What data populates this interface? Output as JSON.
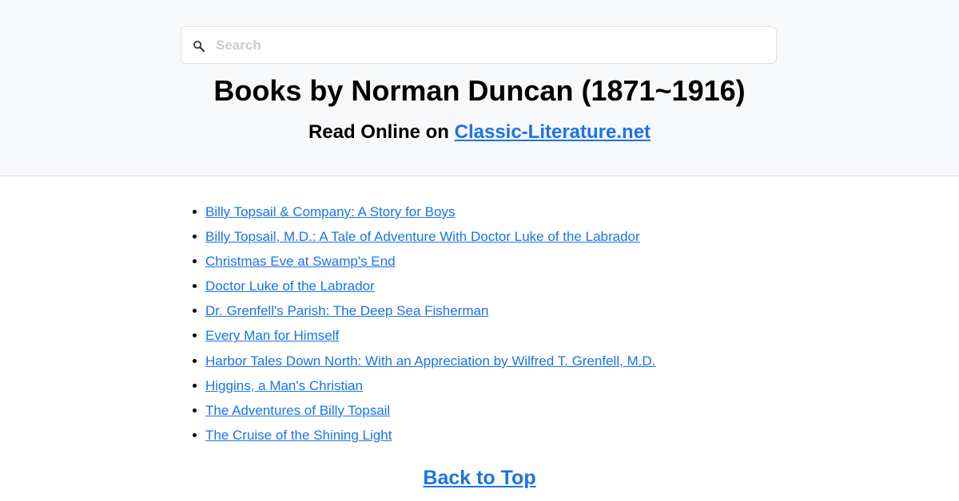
{
  "search": {
    "placeholder": "Search",
    "value": ""
  },
  "header": {
    "title": "Books by Norman Duncan (1871~1916)",
    "subtitle_prefix": "Read Online on ",
    "site_link": "Classic-Literature.net"
  },
  "books": [
    "Billy Topsail & Company: A Story for Boys",
    "Billy Topsail, M.D.: A Tale of Adventure With Doctor Luke of the Labrador",
    "Christmas Eve at Swamp's End",
    "Doctor Luke of the Labrador",
    "Dr. Grenfell's Parish: The Deep Sea Fisherman",
    "Every Man for Himself",
    "Harbor Tales Down North: With an Appreciation by Wilfred T. Grenfell, M.D.",
    "Higgins, a Man's Christian",
    "The Adventures of Billy Topsail",
    "The Cruise of the Shining Light"
  ],
  "footer": {
    "back_to_top": "Back to Top"
  },
  "colors": {
    "link": "#1a73e8",
    "header_bg": "#f7f8fa"
  },
  "icons": {
    "search": "search-icon"
  }
}
